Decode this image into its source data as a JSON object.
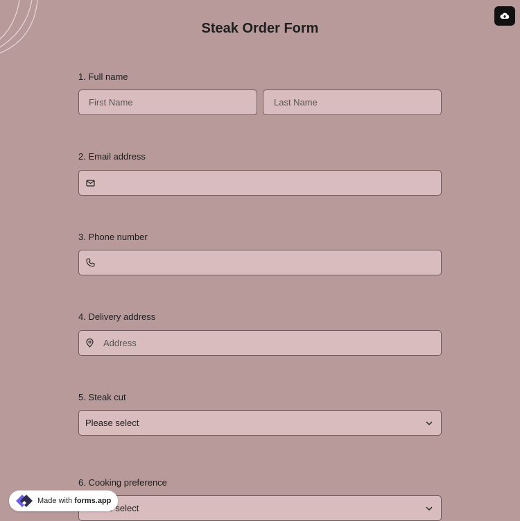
{
  "form": {
    "title": "Steak Order Form",
    "questions": [
      {
        "label": "1.  Full name",
        "first_placeholder": "First Name",
        "last_placeholder": "Last Name"
      },
      {
        "label": "2. Email address"
      },
      {
        "label": "3. Phone number"
      },
      {
        "label": "4. Delivery address",
        "placeholder": "Address"
      },
      {
        "label": "5. Steak cut",
        "value": "Please select"
      },
      {
        "label": "6. Cooking preference",
        "value": "Please select"
      }
    ]
  },
  "badge": {
    "prefix": "Made with ",
    "brand": "forms.app"
  },
  "icons": {
    "save": "cloud-upload-icon",
    "email": "envelope-icon",
    "phone": "phone-icon",
    "address": "map-pin-icon",
    "chevron": "chevron-down-icon",
    "brand_logo": "forms-app-logo"
  },
  "colors": {
    "background": "#b89a9b",
    "field": "#d9bdbe",
    "border": "#6e5a5b"
  }
}
